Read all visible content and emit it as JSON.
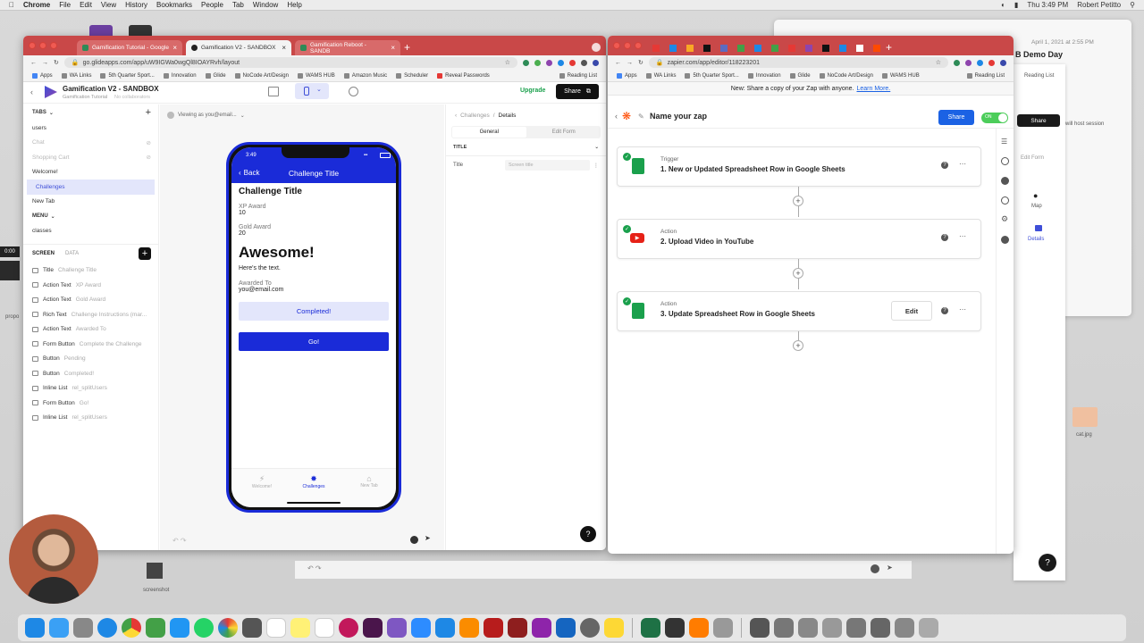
{
  "menubar": {
    "app": "Chrome",
    "items": [
      "File",
      "Edit",
      "View",
      "History",
      "Bookmarks",
      "People",
      "Tab",
      "Window",
      "Help"
    ],
    "clock": "Thu 3:49 PM",
    "user": "Robert Petitto"
  },
  "desktop": {
    "back_window_date": "April 1, 2021 at 2:55 PM",
    "back_window_title": "B Demo Day",
    "back_window_note": "will host session",
    "back_window_edit": "Edit Form",
    "back_window_map": "Map",
    "back_window_details": "Details",
    "back_reading_list": "Reading List",
    "back_share": "Share",
    "label_left": "propo",
    "label_screenshot": "screenshot",
    "label_cat": "cat.jpg",
    "badge_time": "0:00"
  },
  "glide_window": {
    "tabs": [
      {
        "label": "Gamification Tutorial - Google",
        "active": false
      },
      {
        "label": "Gamification V2 - SANDBOX",
        "active": true
      },
      {
        "label": "Gamification Reboot - SANDB",
        "active": false
      }
    ],
    "url": "go.glideapps.com/app/uW9IGWa0wgQl8IOAYRvh/layout",
    "bookmarks": [
      "Apps",
      "WA Links",
      "5th Quarter Sport...",
      "Innovation",
      "Glide",
      "NoCode Art/Design",
      "WAMS HUB",
      "Amazon Music",
      "Scheduler",
      "Reveal Passwords"
    ],
    "reading_list": "Reading List",
    "app_title": "Gamification V2 - SANDBOX",
    "app_subtitle": "Gamification Tutorial",
    "collaborators": "No collaborators",
    "upgrade": "Upgrade",
    "share": "Share",
    "viewing_as": "Viewing as you@email...",
    "tabs_header": "TABS",
    "tab_items": [
      {
        "label": "users",
        "state": "normal"
      },
      {
        "label": "Chat",
        "state": "hidden"
      },
      {
        "label": "Shopping Cart",
        "state": "hidden"
      },
      {
        "label": "Welcome!",
        "state": "normal"
      },
      {
        "label": "Challenges",
        "state": "selected"
      },
      {
        "label": "New Tab",
        "state": "normal"
      }
    ],
    "menu_header": "MENU",
    "menu_items": [
      "classes"
    ],
    "screen_tab": "SCREEN",
    "data_tab": "DATA",
    "components": [
      {
        "type": "Title",
        "value": "Challenge Title"
      },
      {
        "type": "Action Text",
        "value": "XP Award"
      },
      {
        "type": "Action Text",
        "value": "Gold Award"
      },
      {
        "type": "Rich Text",
        "value": "Challenge Instructions (mar..."
      },
      {
        "type": "Action Text",
        "value": "Awarded To"
      },
      {
        "type": "Form Button",
        "value": "Complete the Challenge"
      },
      {
        "type": "Button",
        "value": "Pending"
      },
      {
        "type": "Button",
        "value": "Completed!"
      },
      {
        "type": "Inline List",
        "value": "rel_splitUsers"
      },
      {
        "type": "Form Button",
        "value": "Go!"
      },
      {
        "type": "Inline List",
        "value": "rel_splitUsers"
      }
    ],
    "phone": {
      "time": "3:49",
      "back": "Back",
      "header": "Challenge Title",
      "title": "Challenge Title",
      "xp_label": "XP Award",
      "xp_value": "10",
      "gold_label": "Gold Award",
      "gold_value": "20",
      "big_text": "Awesome!",
      "body_text": "Here's the text.",
      "awarded_label": "Awarded To",
      "awarded_value": "you@email.com",
      "completed_button": "Completed!",
      "go_button": "Go!",
      "nav": [
        {
          "label": "Welcome!",
          "active": false
        },
        {
          "label": "Challenges",
          "active": true
        },
        {
          "label": "New Tab",
          "active": false
        }
      ]
    },
    "props": {
      "breadcrumb_parent": "Challenges",
      "breadcrumb_current": "Details",
      "tab_general": "General",
      "tab_edit_form": "Edit Form",
      "section": "TITLE",
      "field_label": "Title",
      "field_placeholder": "Screen title"
    },
    "help": "?"
  },
  "zapier_window": {
    "url": "zapier.com/app/editor/118223201",
    "bookmarks": [
      "Apps",
      "WA Links",
      "5th Quarter Sport...",
      "Innovation",
      "Glide",
      "NoCode Art/Design",
      "WAMS HUB"
    ],
    "reading_list": "Reading List",
    "banner_text": "New: Share a copy of your Zap with anyone.",
    "banner_link": "Learn More.",
    "zap_name": "Name your zap",
    "share": "Share",
    "toggle": "ON",
    "steps": [
      {
        "kind": "Trigger",
        "title": "1. New or Updated Spreadsheet Row in Google Sheets",
        "app": "sheets",
        "edit": false
      },
      {
        "kind": "Action",
        "title": "2. Upload Video in YouTube",
        "app": "youtube",
        "edit": false
      },
      {
        "kind": "Action",
        "title": "3. Update Spreadsheet Row in Google Sheets",
        "app": "sheets",
        "edit": true
      }
    ],
    "edit_label": "Edit",
    "help": "?",
    "colors": {
      "brand": "#ff4a00",
      "primary": "#1b62e4",
      "toggle": "#4ccd5a"
    }
  },
  "colors": {
    "glide_accent": "#1a2bd8",
    "chrome_tab": "#c94848"
  }
}
